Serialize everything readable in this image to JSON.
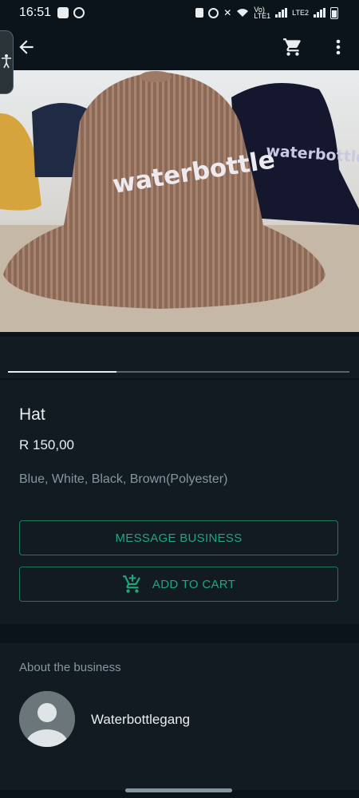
{
  "status_bar": {
    "time": "16:51",
    "network_top": "Vo)",
    "network_lte1": "LTE1",
    "network_lte2": "LTE2"
  },
  "app_bar": {
    "back_icon": "arrow-back-icon",
    "cart_icon": "shopping-cart-icon",
    "more_icon": "more-vert-icon"
  },
  "product_image": {
    "hat_logo_front": "waterbottle",
    "hat_logo_back": "waterbottle"
  },
  "carousel": {
    "position": 1,
    "count": 3
  },
  "product": {
    "name": "Hat",
    "price": "R 150,00",
    "description": "Blue, White, Black, Brown(Polyester)"
  },
  "actions": {
    "message_label": "MESSAGE BUSINESS",
    "add_to_cart_label": "ADD TO CART",
    "add_to_cart_icon": "add-shopping-cart-icon"
  },
  "about": {
    "label": "About the business",
    "business_name": "Waterbottlegang"
  },
  "colors": {
    "background": "#0b141a",
    "panel": "#111b21",
    "accent": "#21a67e",
    "secondary_text": "#8696a0"
  }
}
